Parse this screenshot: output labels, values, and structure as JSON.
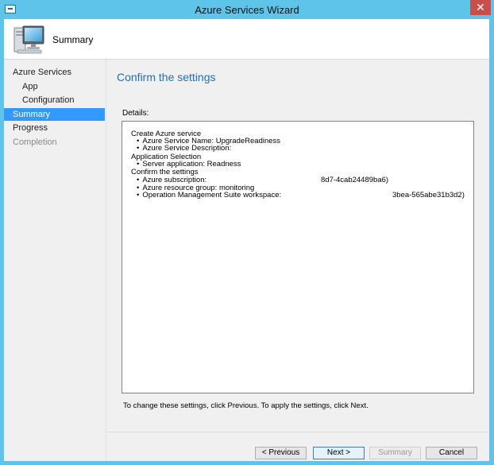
{
  "window": {
    "title": "Azure Services Wizard",
    "close_glyph": "✕"
  },
  "header": {
    "title": "Summary",
    "icon": "computer-monitor-icon"
  },
  "sidebar": {
    "items": [
      {
        "label": "Azure Services",
        "state": "normal"
      },
      {
        "label": "App",
        "state": "normal"
      },
      {
        "label": "Configuration",
        "state": "normal"
      },
      {
        "label": "Summary",
        "state": "selected"
      },
      {
        "label": "Progress",
        "state": "normal"
      },
      {
        "label": "Completion",
        "state": "disabled"
      }
    ]
  },
  "main": {
    "title": "Confirm the settings",
    "details_label": "Details:",
    "details": {
      "create_heading": "Create Azure service",
      "service_name": "Azure Service Name: UpgradeReadiness",
      "service_description": "Azure Service Description:",
      "app_heading": "Application Selection",
      "server_app": "Server application: Readness",
      "confirm_heading": "Confirm the settings",
      "subscription_label": "Azure subscription:",
      "subscription_value": "8d7-4cab24489ba6)",
      "resource_group": "Azure resource group: monitoring",
      "oms_label": "Operation Management Suite workspace:",
      "oms_value": "3bea-565abe31b3d2)"
    },
    "footer_note": "To change these settings, click Previous. To apply the settings, click Next."
  },
  "buttons": {
    "previous": "< Previous",
    "next": "Next >",
    "summary": "Summary",
    "cancel": "Cancel"
  },
  "colors": {
    "title_bar": "#5fc4ea",
    "accent_title": "#1f6fb9",
    "selection": "#3399ff",
    "close": "#c7504a"
  }
}
